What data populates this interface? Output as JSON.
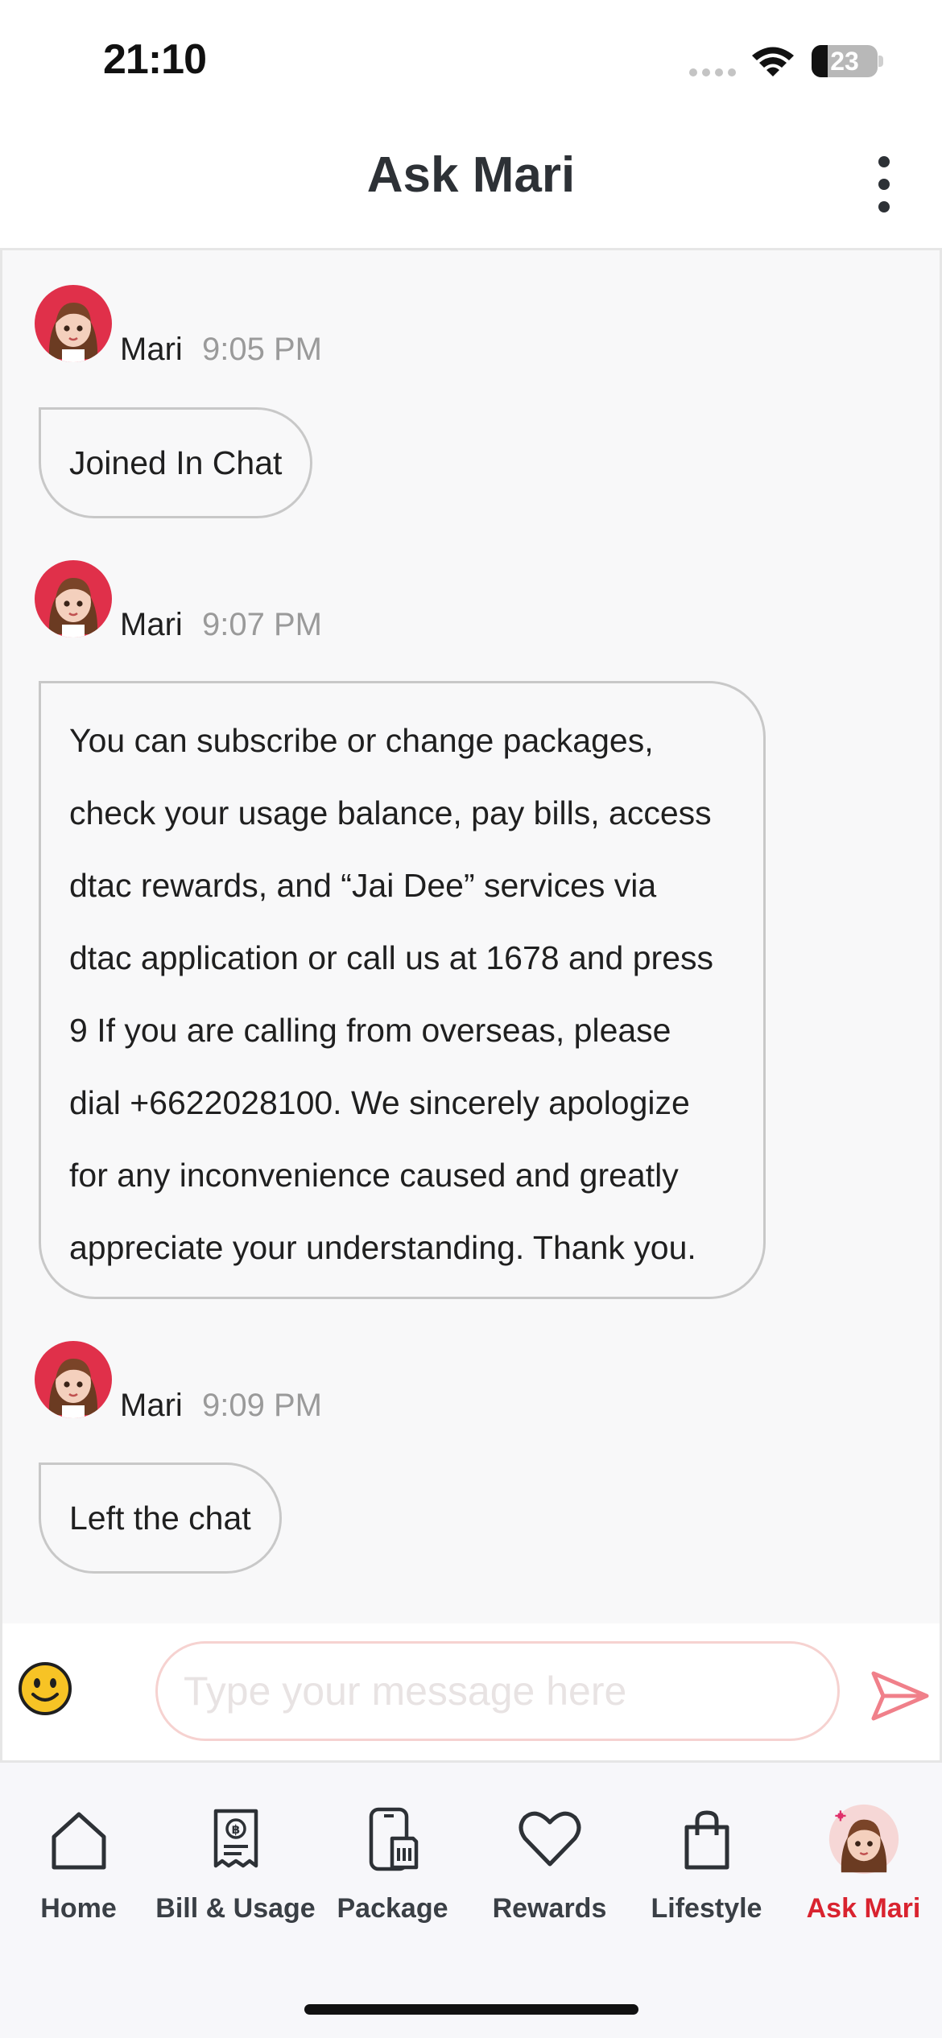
{
  "status_bar": {
    "time": "21:10",
    "battery": "23"
  },
  "header": {
    "title": "Ask Mari",
    "more_icon": "more-vertical-icon"
  },
  "messages": [
    {
      "sender": "Mari",
      "time": "9:05 PM",
      "text": "Joined In Chat"
    },
    {
      "sender": "Mari",
      "time": "9:07 PM",
      "lines": [
        "You can subscribe or change packages,",
        "check your usage balance, pay bills, access",
        "dtac rewards, and “Jai Dee” services via",
        "dtac application or call us at 1678 and press",
        "9 If you are calling from overseas, please",
        "dial +6622028100. We sincerely apologize",
        "for any inconvenience caused and greatly",
        "appreciate your understanding. Thank you."
      ]
    },
    {
      "sender": "Mari",
      "time": "9:09 PM",
      "text": "Left the chat"
    }
  ],
  "input": {
    "placeholder": "Type your message here",
    "value": ""
  },
  "nav": {
    "items": [
      {
        "label": "Home",
        "icon": "home-icon"
      },
      {
        "label": "Bill & Usage",
        "icon": "bill-icon"
      },
      {
        "label": "Package",
        "icon": "sim-phone-icon"
      },
      {
        "label": "Rewards",
        "icon": "heart-icon"
      },
      {
        "label": "Lifestyle",
        "icon": "shopping-bag-icon"
      },
      {
        "label": "Ask Mari",
        "icon": "mari-avatar-icon",
        "active": true
      }
    ]
  },
  "colors": {
    "accent": "#d9232f",
    "avatar_ring": "#e0304a",
    "bubble_border": "#c8c8c8",
    "input_border": "#f6d2d0"
  }
}
